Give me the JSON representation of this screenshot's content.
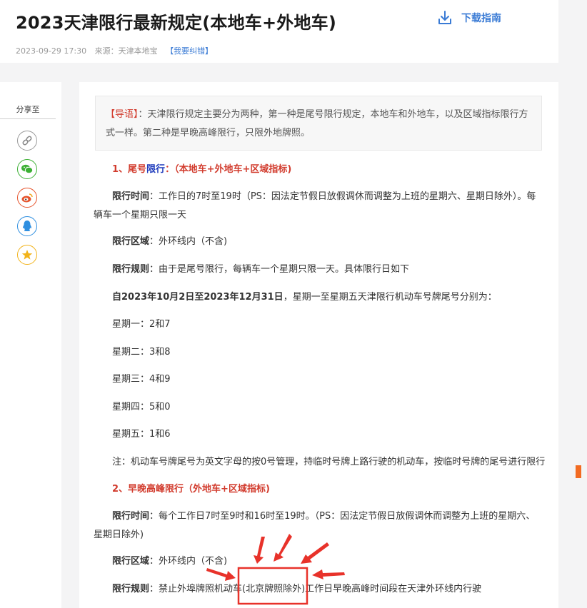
{
  "header": {
    "title": "2023天津限行最新规定(本地车+外地车)",
    "date": "2023-09-29 17:30",
    "source": "来源：天津本地宝",
    "correction_link": "【我要纠错】",
    "download_label": "下载指南"
  },
  "share": {
    "label": "分享至",
    "buttons": [
      {
        "name": "link-icon",
        "color": "#8a8a8a"
      },
      {
        "name": "wechat-icon",
        "color": "#3cb034"
      },
      {
        "name": "weibo-icon",
        "color": "#e6542c"
      },
      {
        "name": "qq-icon",
        "color": "#2f8fe0"
      },
      {
        "name": "favorite-icon",
        "color": "#f2b31a"
      }
    ]
  },
  "article": {
    "intro_tag": "【导语】",
    "intro_text": "：天津限行规定主要分为两种，第一种是尾号限行规定，本地车和外地车，以及区域指标限行方式一样。第二种是早晚高峰限行，只限外地牌照。",
    "s1_num": "1、尾号",
    "s1_blue": "限行",
    "s1_colon": "：",
    "s1_sub": "（本地车+外地车+区域指标)",
    "time_label": "限行时间",
    "time_text": "：工作日的7时至19时（PS：因法定节假日放假调休而调整为上班的星期六、星期日除外）。每辆车一个星期只限一天",
    "area_label": "限行区域",
    "area_text": "：外环线内（不含)",
    "rule_label": "限行规则",
    "rule_text": "：由于是尾号限行，每辆车一个星期只限一天。具体限行日如下",
    "period_bold": "自2023年10月2日至2023年12月31日",
    "period_text": "，星期一至星期五天津限行机动车号牌尾号分别为：",
    "days": [
      "星期一：2和7",
      "星期二：3和8",
      "星期三：4和9",
      "星期四：5和0",
      "星期五：1和6"
    ],
    "note": "注：机动车号牌尾号为英文字母的按0号管理，持临时号牌上路行驶的机动车，按临时号牌的尾号进行限行",
    "s2_title": "2、早晚高峰限行（外地车+区域指标)",
    "time2_text": "：每个工作日7时至9时和16时至19时。（PS：因法定节假日放假调休而调整为上班的星期六、星期日除外)",
    "area2_text": "：外环线内（不含)",
    "rule2_text_a": "：禁止外埠牌照机动车(",
    "rule2_highlight": "北京牌照除外",
    "rule2_text_b": ")工作日早晚高峰时间段在天津外环线内行驶"
  },
  "colors": {
    "accent_red": "#d23c2e",
    "link_blue": "#3a7bd5",
    "annotation_red": "#e8322a"
  }
}
